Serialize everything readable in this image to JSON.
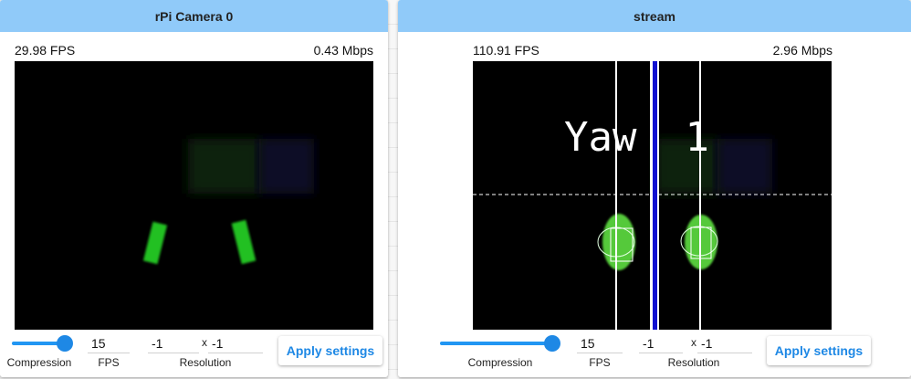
{
  "panels": [
    {
      "title": "rPi Camera 0",
      "fps_stat": "29.98 FPS",
      "bitrate_stat": "0.43 Mbps",
      "compression_label": "Compression",
      "compression_level": 1.0,
      "fps_value": "15",
      "fps_label": "FPS",
      "res_width": "-1",
      "res_sep": "x",
      "res_height": "-1",
      "res_label": "Resolution",
      "apply_label": "Apply settings"
    },
    {
      "title": "stream",
      "fps_stat": "110.91 FPS",
      "bitrate_stat": "2.96 Mbps",
      "compression_label": "Compression",
      "compression_level": 1.0,
      "fps_value": "15",
      "fps_label": "FPS",
      "res_width": "-1",
      "res_sep": "x",
      "res_height": "-1",
      "res_label": "Resolution",
      "apply_label": "Apply settings",
      "overlay_text": "Yaw  1"
    }
  ],
  "colors": {
    "header_bg": "#90caf9",
    "accent": "#1e88e5",
    "target_green": "#3cc43c",
    "overlay_blue": "#1010d0"
  }
}
